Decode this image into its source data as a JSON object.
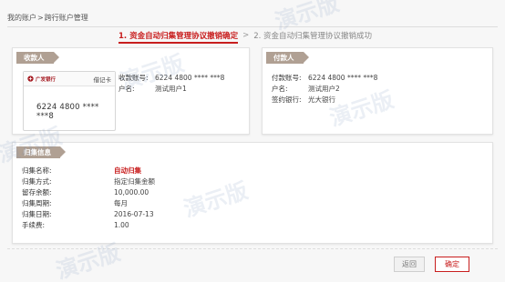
{
  "breadcrumb": {
    "home": "我的账户",
    "separator": ">",
    "current": "跨行账户管理"
  },
  "steps": {
    "active": "1. 资金自动归集管理协议撤销确定",
    "arrow": ">",
    "next": "2. 资金自动归集管理协议撤销成功"
  },
  "payee": {
    "tag": "收款人",
    "card": {
      "bank_name": "广发银行",
      "type": "借记卡",
      "number": "6224 4800 **** ***8"
    },
    "fields": [
      {
        "label": "收款账号:",
        "value": "6224 4800 **** ***8"
      },
      {
        "label": "户名:",
        "value": "测试用户1"
      }
    ]
  },
  "payer": {
    "tag": "付款人",
    "fields": [
      {
        "label": "付款账号:",
        "value": "6224 4800 **** ***8"
      },
      {
        "label": "户名:",
        "value": "测试用户2"
      },
      {
        "label": "签约银行:",
        "value": "光大银行"
      }
    ]
  },
  "collect": {
    "tag": "归集信息",
    "fields": [
      {
        "label": "归集名称:",
        "value": "自动归集"
      },
      {
        "label": "归集方式:",
        "value": "指定归集金额"
      },
      {
        "label": "留存余额:",
        "value": "10,000.00"
      },
      {
        "label": "归集周期:",
        "value": "每月"
      },
      {
        "label": "归集日期:",
        "value": "2016-07-13"
      },
      {
        "label": "手续费:",
        "value": "1.00"
      }
    ]
  },
  "buttons": {
    "back": "返回",
    "confirm": "确定"
  },
  "watermarks": [
    "演示版",
    "演示版",
    "演示版",
    "演示版",
    "演示版",
    "演示版"
  ],
  "colors": {
    "accent": "#c81e1e",
    "tag": "#b0a093"
  }
}
